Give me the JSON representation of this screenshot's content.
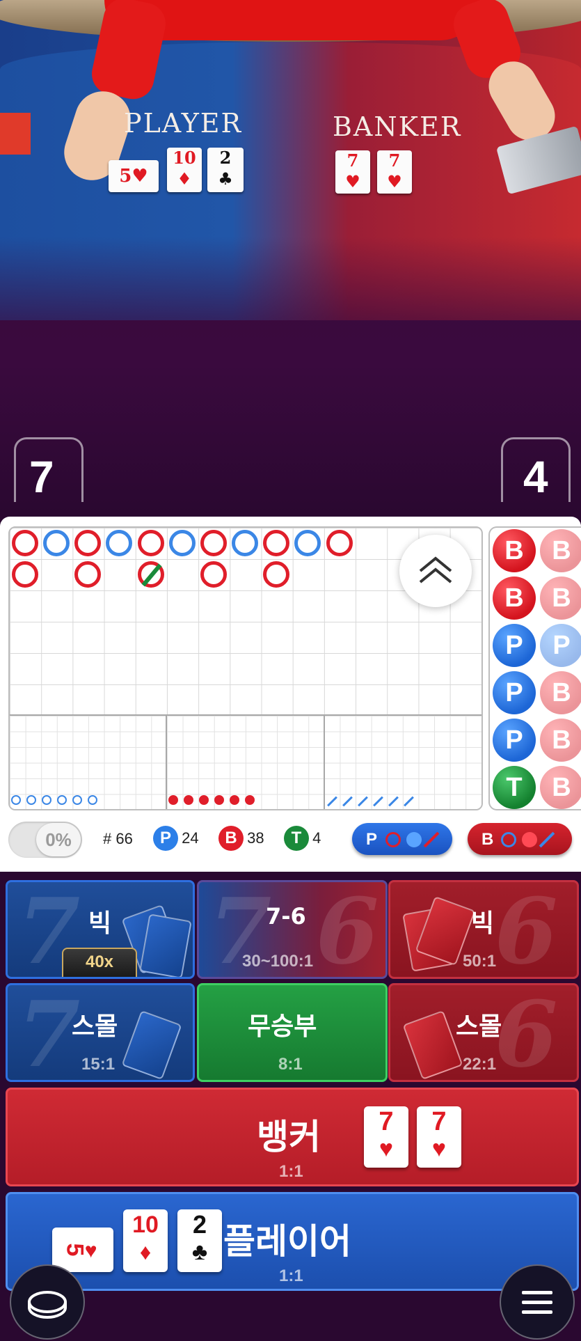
{
  "table": {
    "player_label": "PLAYER",
    "banker_label": "BANKER",
    "player_cards": [
      {
        "rank": "5",
        "suit": "♥"
      },
      {
        "rank": "10",
        "suit": "♦"
      },
      {
        "rank": "2",
        "suit": "♣"
      }
    ],
    "banker_cards": [
      {
        "rank": "7",
        "suit": "♥"
      },
      {
        "rank": "7",
        "suit": "♥"
      }
    ],
    "player_score": "7",
    "banker_score": "4"
  },
  "stats": {
    "percent": "0%",
    "round": "# 66",
    "player_letter": "P",
    "player_count": "24",
    "banker_letter": "B",
    "banker_count": "38",
    "tie_letter": "T",
    "tie_count": "4",
    "player_predict_label": "P",
    "banker_predict_label": "B"
  },
  "bead_road": [
    "B",
    "B",
    "P",
    "P",
    "P",
    "T"
  ],
  "bets": {
    "player_big": {
      "title": "빅",
      "badge": "40x"
    },
    "seven_six": {
      "title": "7-6",
      "odds": "30~100:1"
    },
    "banker_big": {
      "title": "빅",
      "odds": "50:1"
    },
    "player_small": {
      "title": "스몰",
      "odds": "15:1"
    },
    "tie": {
      "title": "무승부",
      "odds": "8:1"
    },
    "banker_small": {
      "title": "스몰",
      "odds": "22:1"
    },
    "banker": {
      "title": "뱅커",
      "odds": "1:1"
    },
    "player": {
      "title": "플레이어",
      "odds": "1:1"
    }
  },
  "colors": {
    "banker": "#e01e2a",
    "player": "#3b87e6",
    "tie": "#1a8a3a"
  }
}
